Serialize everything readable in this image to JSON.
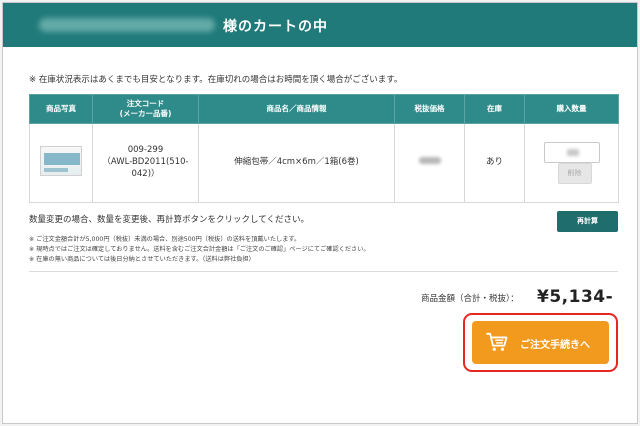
{
  "header": {
    "title": "様のカートの中",
    "color": "#1f7a79"
  },
  "notice": "※ 在庫状況表示はあくまでも目安となります。在庫切れの場合はお時間を頂く場合がございます。",
  "table": {
    "columns": [
      "商品写真",
      "注文コード\n(メーカー品番)",
      "商品名／商品情報",
      "税抜価格",
      "在庫",
      "購入数量"
    ],
    "rows": [
      {
        "code_line1": "009-299",
        "code_line2": "（AWL-BD2011(510-",
        "code_line3": "042)）",
        "name": "伸縮包帯／4cm×6m／1箱(6巻)",
        "stock": "あり",
        "delete_label": "削除"
      }
    ]
  },
  "qty_note": "数量変更の場合、数量を変更後、再計算ボタンをクリックしてください。",
  "recalc_label": "再計算",
  "small_notes": [
    "※ ご注文金額合計が5,000円（税抜）未満の場合、別途500円（税抜）の送料を頂戴いたします。",
    "※ 現時点ではご注文は確定しておりません。送料を含むご注文合計金額は「ご注文のご確認」ページにてご確認ください。",
    "※ 在庫の無い商品については後日分納とさせていただきます。（送料は弊社負担）"
  ],
  "total": {
    "label": "商品金額（合計・税抜）：",
    "value": "¥5,134-"
  },
  "order_button": {
    "label": "ご注文手続きへ",
    "icon": "cart-icon",
    "color": "#f29a1d",
    "highlight_color": "#e8251f"
  }
}
